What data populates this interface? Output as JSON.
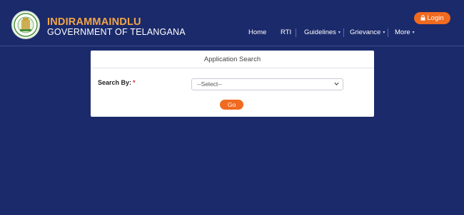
{
  "brand": {
    "title": "INDIRAMMAINDLU",
    "subtitle": "GOVERNMENT OF TELANGANA"
  },
  "header": {
    "login_label": "Login"
  },
  "nav": {
    "items": [
      {
        "label": "Home"
      },
      {
        "label": "RTI"
      },
      {
        "label": "Guidelines"
      },
      {
        "label": "Grievance"
      },
      {
        "label": "More"
      }
    ]
  },
  "card": {
    "title": "Application Search",
    "search_label": "Search By:",
    "required_mark": "*",
    "select_value": "--Select--",
    "go_label": "Go"
  },
  "colors": {
    "background": "#1b2a6b",
    "brand_accent": "#f4a545",
    "button": "#f06a1f",
    "required": "#d32f2f"
  }
}
